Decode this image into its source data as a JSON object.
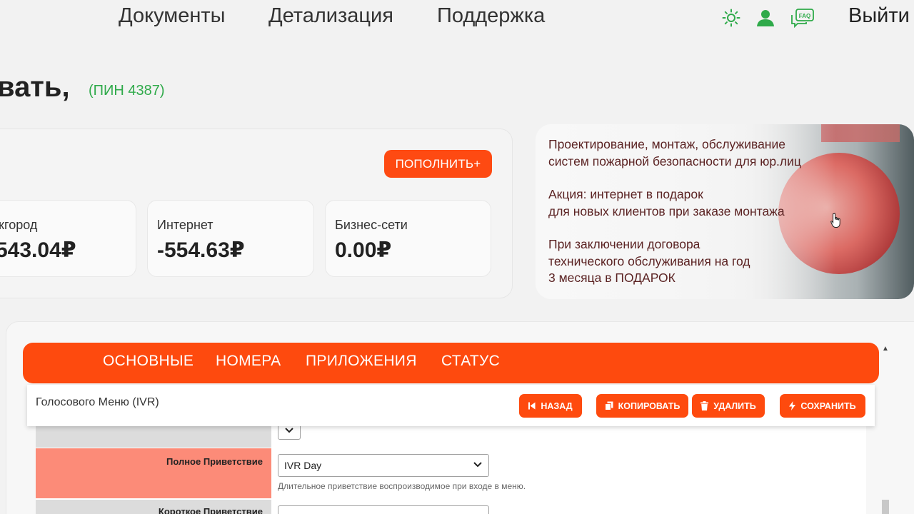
{
  "nav": {
    "links": [
      "Документы",
      "Детализация",
      "Поддержка"
    ],
    "logout": "Выйти",
    "icons": [
      "sun-icon",
      "user-icon",
      "faq-icon"
    ],
    "faq_text": "FAQ"
  },
  "header": {
    "greeting": "вать,",
    "pin": "(ПИН 4387)"
  },
  "balance": {
    "topup_label": "ПОПОЛНИТЬ+",
    "accounts": [
      {
        "label": "жгород",
        "value": "543.04₽"
      },
      {
        "label": "Интернет",
        "value": "-554.63₽"
      },
      {
        "label": "Бизнес-сети",
        "value": "0.00₽"
      }
    ]
  },
  "promo": {
    "lines": [
      "Проектирование, монтаж, обслуживание",
      "систем пожарной безопасности для юр.лиц",
      "Акция: интернет в подарок",
      "для новых клиентов при заказе монтажа",
      "При заключении договора",
      "технического обслуживания на год",
      "3 месяца в ПОДАРОК"
    ]
  },
  "tabs": [
    "ОСНОВНЫЕ",
    "НОМЕРА",
    "ПРИЛОЖЕНИЯ",
    "СТАТУС"
  ],
  "toolbar": {
    "title": "Голосового Меню (IVR)",
    "back_label": "НАЗАД",
    "copy_label": "КОПИРОВАТЬ",
    "delete_label": "УДАЛИТЬ",
    "save_label": "СОХРАНИТЬ"
  },
  "form": {
    "row_full_greeting_label": "Полное Приветствие",
    "row_full_greeting_value": "IVR Day",
    "row_full_greeting_hint": "Длительное приветствие воспроизводимое при входе в меню.",
    "row_short_greeting_label": "Короткое Приветствие"
  },
  "colors": {
    "accent": "#fe4a0e",
    "green": "#2faa4a",
    "highlight_row": "#fc8b78"
  }
}
